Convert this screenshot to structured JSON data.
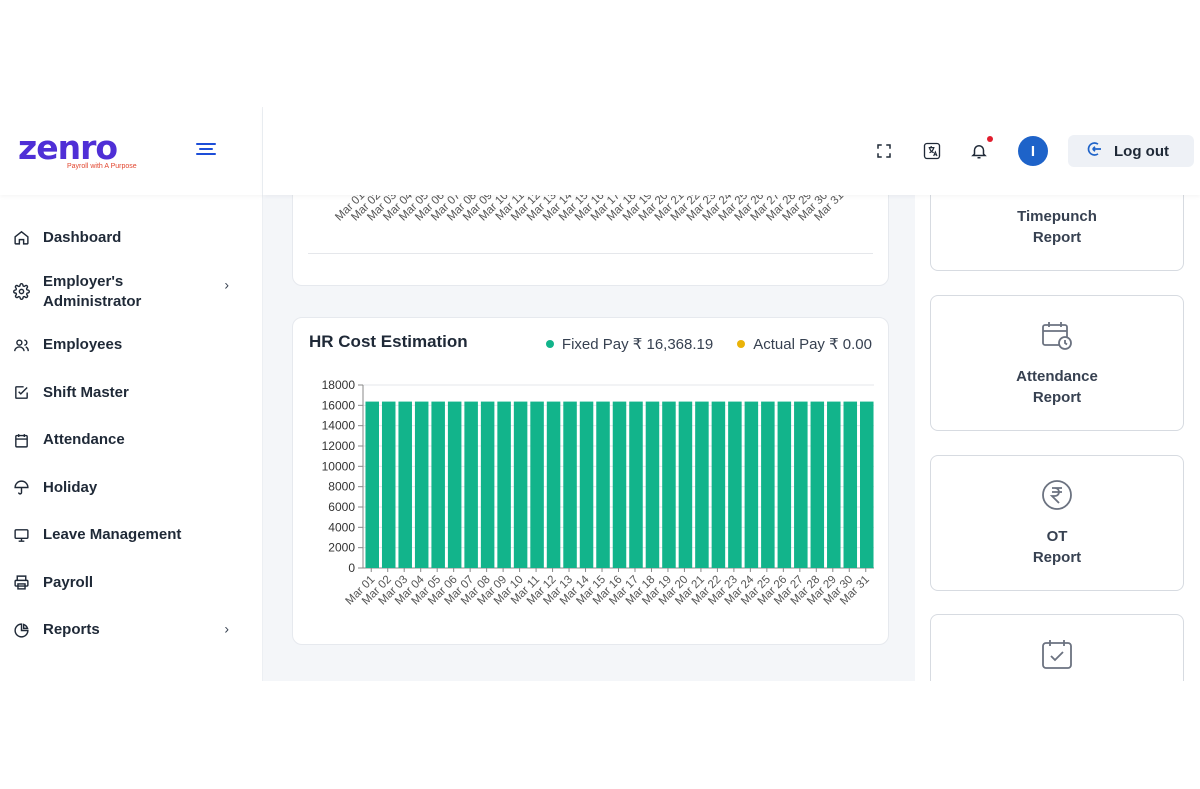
{
  "brand": {
    "name": "zenro",
    "tagline": "Payroll with A Purpose"
  },
  "colors": {
    "accent": "#1e63c9",
    "bar": "#12b48b",
    "fixed_dot": "#12b48b",
    "actual_dot": "#eab308",
    "logo": "#4f2fd6"
  },
  "sidebar": {
    "items": [
      {
        "label": "Dashboard",
        "icon": "home-icon"
      },
      {
        "label": "Employer's Administrator",
        "icon": "gear-icon",
        "chevron": true
      },
      {
        "label": "Employees",
        "icon": "users-icon"
      },
      {
        "label": "Shift Master",
        "icon": "check-square-icon"
      },
      {
        "label": "Attendance",
        "icon": "calendar-icon"
      },
      {
        "label": "Holiday",
        "icon": "umbrella-icon"
      },
      {
        "label": "Leave Management",
        "icon": "monitor-icon"
      },
      {
        "label": "Payroll",
        "icon": "printer-icon"
      },
      {
        "label": "Reports",
        "icon": "pie-chart-icon",
        "chevron": true
      }
    ]
  },
  "header": {
    "avatar_initial": "I",
    "logout_label": "Log out"
  },
  "hr_card": {
    "title": "HR Cost Estimation",
    "legend_fixed": "Fixed Pay ₹ 16,368.19",
    "legend_actual": "Actual Pay ₹ 0.00"
  },
  "report_cards": [
    {
      "label": "Timepunch\nReport",
      "icon": "none"
    },
    {
      "label": "Attendance\nReport",
      "icon": "calendar-clock-icon"
    },
    {
      "label": "OT\nReport",
      "icon": "rupee-circle-icon"
    },
    {
      "label": "",
      "icon": "calendar-check-icon"
    }
  ],
  "chart_data": [
    {
      "type": "bar",
      "categories": [
        "Mar 01",
        "Mar 02",
        "Mar 03",
        "Mar 04",
        "Mar 05",
        "Mar 06",
        "Mar 07",
        "Mar 08",
        "Mar 09",
        "Mar 10",
        "Mar 11",
        "Mar 12",
        "Mar 13",
        "Mar 14",
        "Mar 15",
        "Mar 16",
        "Mar 17",
        "Mar 18",
        "Mar 19",
        "Mar 20",
        "Mar 21",
        "Mar 22",
        "Mar 23",
        "Mar 24",
        "Mar 25",
        "Mar 26",
        "Mar 27",
        "Mar 28",
        "Mar 29",
        "Mar 30",
        "Mar 31"
      ],
      "note_visible": "x-axis tick labels only (chart body scrolled out of view)"
    },
    {
      "type": "bar",
      "title": "HR Cost Estimation",
      "categories": [
        "Mar 01",
        "Mar 02",
        "Mar 03",
        "Mar 04",
        "Mar 05",
        "Mar 06",
        "Mar 07",
        "Mar 08",
        "Mar 09",
        "Mar 10",
        "Mar 11",
        "Mar 12",
        "Mar 13",
        "Mar 14",
        "Mar 15",
        "Mar 16",
        "Mar 17",
        "Mar 18",
        "Mar 19",
        "Mar 20",
        "Mar 21",
        "Mar 22",
        "Mar 23",
        "Mar 24",
        "Mar 25",
        "Mar 26",
        "Mar 27",
        "Mar 28",
        "Mar 29",
        "Mar 30",
        "Mar 31"
      ],
      "series": [
        {
          "name": "Fixed Pay",
          "values": [
            16368.19,
            16368.19,
            16368.19,
            16368.19,
            16368.19,
            16368.19,
            16368.19,
            16368.19,
            16368.19,
            16368.19,
            16368.19,
            16368.19,
            16368.19,
            16368.19,
            16368.19,
            16368.19,
            16368.19,
            16368.19,
            16368.19,
            16368.19,
            16368.19,
            16368.19,
            16368.19,
            16368.19,
            16368.19,
            16368.19,
            16368.19,
            16368.19,
            16368.19,
            16368.19,
            16368.19
          ]
        },
        {
          "name": "Actual Pay",
          "values": [
            0,
            0,
            0,
            0,
            0,
            0,
            0,
            0,
            0,
            0,
            0,
            0,
            0,
            0,
            0,
            0,
            0,
            0,
            0,
            0,
            0,
            0,
            0,
            0,
            0,
            0,
            0,
            0,
            0,
            0,
            0
          ]
        }
      ],
      "yticks": [
        0,
        2000,
        4000,
        6000,
        8000,
        10000,
        12000,
        14000,
        16000,
        18000
      ],
      "ylim": [
        0,
        18000
      ],
      "grid": true,
      "legend_position": "top-right"
    }
  ]
}
